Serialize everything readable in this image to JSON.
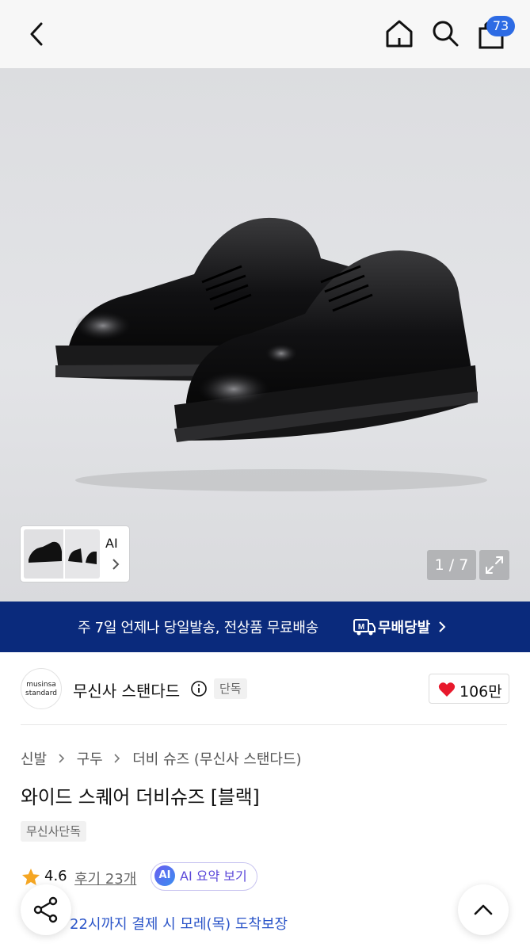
{
  "header": {
    "back_icon": "back-chevron-icon",
    "home_icon": "home-icon",
    "search_icon": "search-icon",
    "cart_icon": "shopping-bag-icon",
    "cart_count": "73"
  },
  "gallery": {
    "ai_label": "AI",
    "counter": "1 / 7",
    "expand_icon": "expand-icon"
  },
  "banner": {
    "text": "주 7일 언제나 당일발송, 전상품 무료배송",
    "badge_text": "무배당발",
    "color": "#0a2a7c"
  },
  "brand": {
    "logo_line1": "musinsa",
    "logo_line2": "standard",
    "name": "무신사 스탠다드",
    "exclusive_tag": "단독",
    "likes": "106만"
  },
  "breadcrumb": [
    "신발",
    "구두",
    "더비 슈즈 (무신사 스탠다드)"
  ],
  "product": {
    "title": "와이드 스퀘어 더비슈즈 [블랙]",
    "tag": "무신사단독",
    "rating": "4.6",
    "reviews": "후기 23개",
    "ai_summary_badge": "AI",
    "ai_summary_label": "AI 요약 보기",
    "delivery_note": "22시까지 결제 시 모레(목) 도착보장"
  },
  "fabs": {
    "share_icon": "share-icon",
    "top_icon": "scroll-top-icon"
  }
}
